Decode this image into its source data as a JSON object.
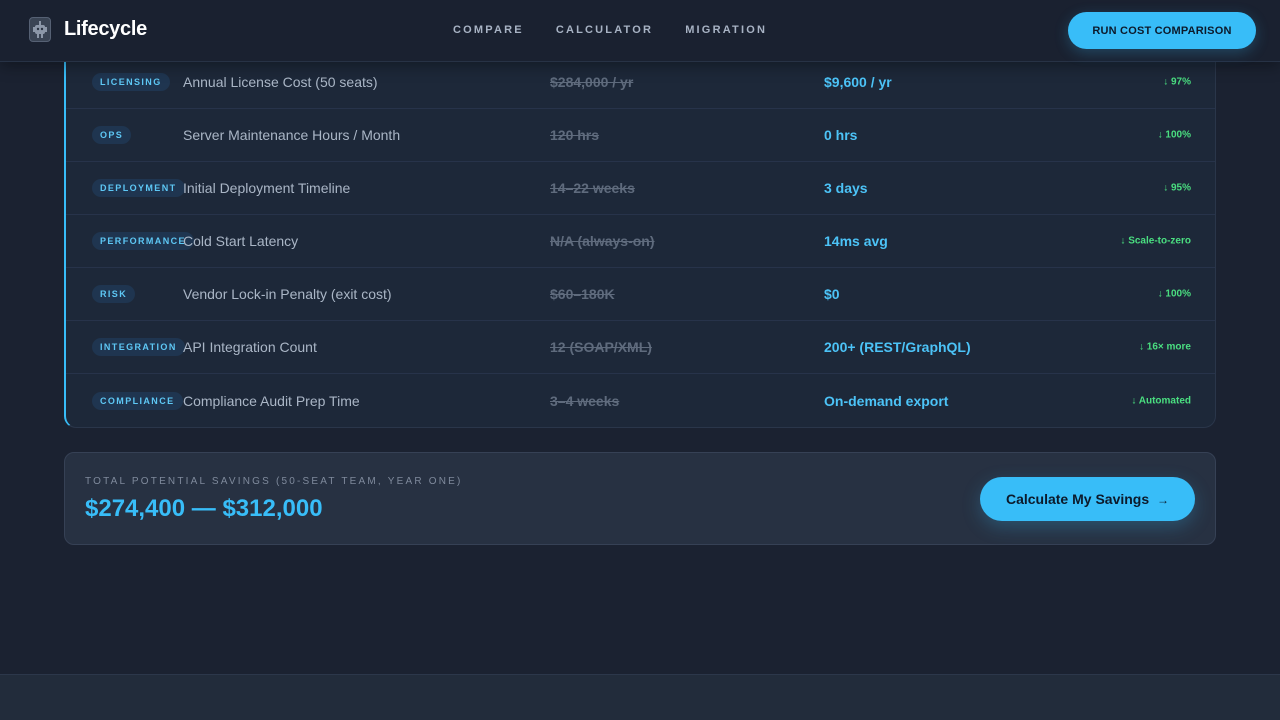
{
  "header": {
    "brand": "Lifecycle",
    "logo_icon": "robot-icon",
    "nav": [
      "COMPARE",
      "CALCULATOR",
      "MIGRATION"
    ],
    "cta": "RUN COST COMPARISON"
  },
  "table": {
    "rows": [
      {
        "tag": "LICENSING",
        "metric": "Annual License Cost (50 seats)",
        "old": "$284,000 / yr",
        "new": "$9,600 / yr",
        "delta": "↓ 97%"
      },
      {
        "tag": "OPS",
        "metric": "Server Maintenance Hours / Month",
        "old": "120 hrs",
        "new": "0 hrs",
        "delta": "↓ 100%"
      },
      {
        "tag": "DEPLOYMENT",
        "metric": "Initial Deployment Timeline",
        "old": "14–22 weeks",
        "new": "3 days",
        "delta": "↓ 95%"
      },
      {
        "tag": "PERFORMANCE",
        "metric": "Cold Start Latency",
        "old": "N/A (always-on)",
        "new": "14ms avg",
        "delta": "↓ Scale-to-zero"
      },
      {
        "tag": "RISK",
        "metric": "Vendor Lock-in Penalty (exit cost)",
        "old": "$60–180K",
        "new": "$0",
        "delta": "↓ 100%"
      },
      {
        "tag": "INTEGRATION",
        "metric": "API Integration Count",
        "old": "12 (SOAP/XML)",
        "new": "200+ (REST/GraphQL)",
        "delta": "↓ 16× more"
      },
      {
        "tag": "COMPLIANCE",
        "metric": "Compliance Audit Prep Time",
        "old": "3–4 weeks",
        "new": "On-demand export",
        "delta": "↓ Automated"
      }
    ]
  },
  "savings": {
    "label": "TOTAL POTENTIAL SAVINGS (50-SEAT TEAM, YEAR ONE)",
    "value": "$274,400 — $312,000",
    "button": "Calculate My Savings",
    "button_arrow": "→"
  },
  "colors": {
    "accent": "#38bdf8",
    "positive": "#4ade80",
    "background": "#1b2231"
  }
}
